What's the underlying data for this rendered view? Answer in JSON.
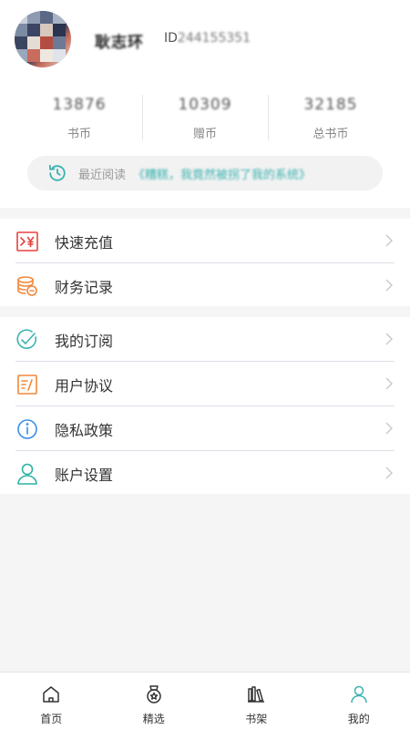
{
  "profile": {
    "nickname": "耿志环",
    "id_prefix": "ID",
    "id_number": "244155351"
  },
  "stats": [
    {
      "value": "13876",
      "label": "书币"
    },
    {
      "value": "10309",
      "label": "赠币"
    },
    {
      "value": "32185",
      "label": "总书币"
    }
  ],
  "recent": {
    "icon": "history-icon",
    "label": "最近阅读",
    "book": "《糟糕，我竟然被拐了我的系统》"
  },
  "menu_group_1": [
    {
      "label": "快速充值",
      "icon": "recharge-icon"
    },
    {
      "label": "财务记录",
      "icon": "coins-stack-icon"
    }
  ],
  "menu_group_2": [
    {
      "label": "我的订阅",
      "icon": "check-circle-icon"
    },
    {
      "label": "用户协议",
      "icon": "document-icon"
    },
    {
      "label": "隐私政策",
      "icon": "info-circle-icon"
    },
    {
      "label": "账户设置",
      "icon": "user-icon"
    }
  ],
  "tabbar": [
    {
      "label": "首页",
      "icon": "home-icon"
    },
    {
      "label": "精选",
      "icon": "medal-icon"
    },
    {
      "label": "书架",
      "icon": "bookshelf-icon"
    },
    {
      "label": "我的",
      "icon": "profile-icon",
      "active": true
    }
  ],
  "colors": {
    "accent": "#3cb3b0",
    "recharge_red": "#e8423f",
    "finance_orange": "#f0883a",
    "subscribe_teal": "#3cb3b0",
    "agreement_orange": "#f0883a",
    "privacy_blue": "#3a8ee6",
    "account_teal": "#2bb3a3"
  }
}
